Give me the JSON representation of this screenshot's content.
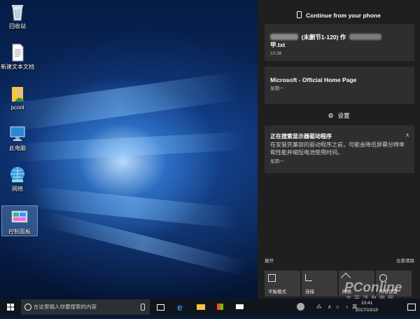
{
  "desktop": {
    "icons": [
      {
        "label": "回收站",
        "icon": "recycle-bin-icon"
      },
      {
        "label": "新建文本文档",
        "icon": "text-document-icon"
      },
      {
        "label": "pconl",
        "icon": "user-folder-icon"
      },
      {
        "label": "此电脑",
        "icon": "computer-icon"
      },
      {
        "label": "网络",
        "icon": "network-icon"
      },
      {
        "label": "控制面板",
        "icon": "control-panel-icon"
      }
    ]
  },
  "action_center": {
    "continue_header": "Continue from your phone",
    "cards": [
      {
        "title_line1": "(未删节1-120) 作",
        "title_line2": "甲.txt",
        "time": "10:38"
      },
      {
        "title": "Microsoft - Official Home Page",
        "time": "星期一"
      }
    ],
    "settings_label": "设置",
    "notification": {
      "title": "正在搜索显示器驱动程序",
      "body": "在安装完兼容的驱动程序之前，可能会降低屏幕分辨率和性能并缩短电池使用时间。",
      "time": "星期一"
    },
    "expand_label": "展开",
    "clear_all_label": "全部清除",
    "quick_actions": [
      {
        "label": "平板模式",
        "icon": "tablet-mode-icon"
      },
      {
        "label": "连接",
        "icon": "connect-icon"
      },
      {
        "label": "网络",
        "icon": "network-icon"
      },
      {
        "label": "所有设置",
        "icon": "all-settings-icon"
      }
    ]
  },
  "taskbar": {
    "search_placeholder": "在这里输入你要搜索的内容",
    "ime": "英",
    "clock_time": "10:41",
    "clock_date": "2017/10/10"
  },
  "watermark": {
    "brand": "PConline",
    "sub": "太平洋电脑网"
  },
  "colors": {
    "action_center_bg": "#1f1f1f",
    "card_bg": "#2e2e2e",
    "taskbar_bg": "#10151d",
    "accent": "#2d8ae5"
  }
}
